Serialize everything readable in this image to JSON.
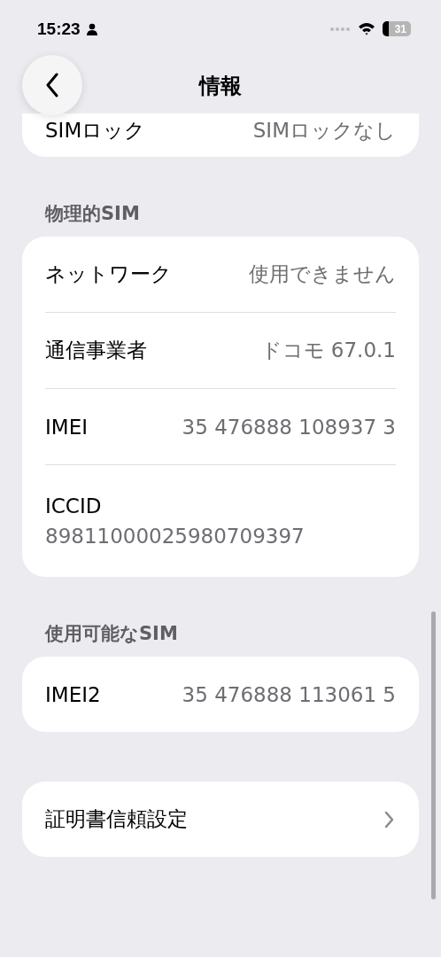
{
  "status_bar": {
    "time": "15:23",
    "battery": "31"
  },
  "nav": {
    "title": "情報"
  },
  "top_row": {
    "label": "SIMロック",
    "value": "SIMロックなし"
  },
  "sections": [
    {
      "header": "物理的SIM",
      "rows": [
        {
          "kind": "pair",
          "label": "ネットワーク",
          "value": "使用できません"
        },
        {
          "kind": "pair",
          "label": "通信事業者",
          "value": "ドコモ 67.0.1"
        },
        {
          "kind": "pair",
          "label": "IMEI",
          "value": "35 476888 108937 3"
        },
        {
          "kind": "stacked",
          "label": "ICCID",
          "value": "89811000025980709397"
        }
      ]
    },
    {
      "header": "使用可能なSIM",
      "rows": [
        {
          "kind": "pair",
          "label": "IMEI2",
          "value": "35 476888 113061 5"
        }
      ]
    }
  ],
  "link_row": {
    "label": "証明書信頼設定"
  }
}
